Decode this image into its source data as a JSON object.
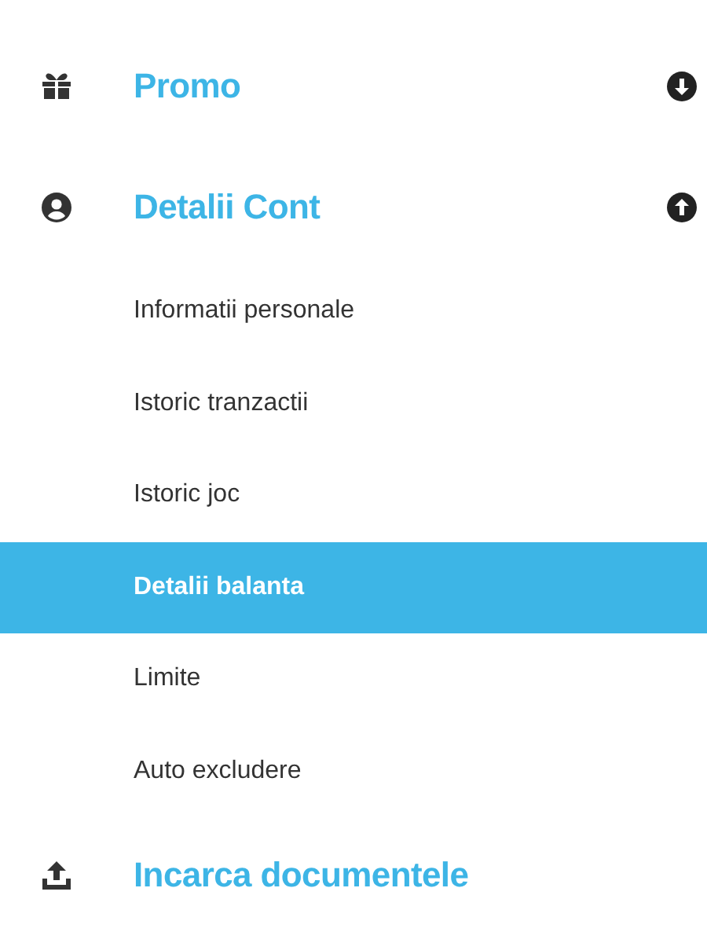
{
  "menu": [
    {
      "label": "Promo",
      "expanded": false
    },
    {
      "label": "Detalii Cont",
      "expanded": true,
      "children": [
        {
          "label": "Informatii personale",
          "selected": false
        },
        {
          "label": "Istoric tranzactii",
          "selected": false
        },
        {
          "label": "Istoric joc",
          "selected": false
        },
        {
          "label": "Detalii balanta",
          "selected": true
        },
        {
          "label": "Limite",
          "selected": false
        },
        {
          "label": "Auto excludere",
          "selected": false
        }
      ]
    },
    {
      "label": "Incarca documentele"
    }
  ]
}
